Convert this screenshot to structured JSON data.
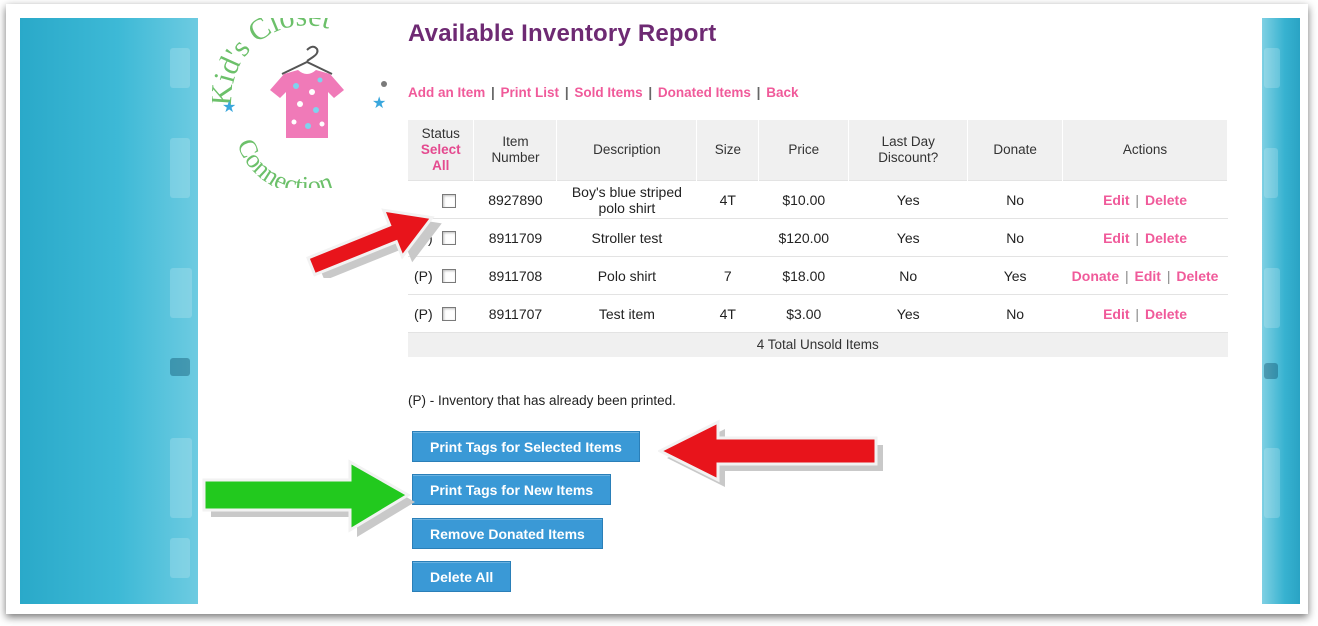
{
  "logo": {
    "text_top": "Kid's Closet",
    "text_bottom": "Connection"
  },
  "page": {
    "title": "Available Inventory Report"
  },
  "links": [
    {
      "label": "Add an Item"
    },
    {
      "label": "Print List"
    },
    {
      "label": "Sold Items"
    },
    {
      "label": "Donated Items"
    },
    {
      "label": "Back"
    }
  ],
  "table": {
    "headers": {
      "status": "Status",
      "select_all": "Select All",
      "item_number": "Item Number",
      "description": "Description",
      "size": "Size",
      "price": "Price",
      "last_day_discount": "Last Day Discount?",
      "donate": "Donate",
      "actions": "Actions"
    },
    "rows": [
      {
        "status": "",
        "checked": false,
        "item_number": "8927890",
        "description": "Boy's blue striped polo shirt",
        "size": "4T",
        "price": "$10.00",
        "last_day_discount": "Yes",
        "donate": "No",
        "actions": [
          "Edit",
          "Delete"
        ]
      },
      {
        "status": "(P)",
        "checked": false,
        "item_number": "8911709",
        "description": "Stroller test",
        "size": "",
        "price": "$120.00",
        "last_day_discount": "Yes",
        "donate": "No",
        "actions": [
          "Edit",
          "Delete"
        ]
      },
      {
        "status": "(P)",
        "checked": false,
        "item_number": "8911708",
        "description": "Polo shirt",
        "size": "7",
        "price": "$18.00",
        "last_day_discount": "No",
        "donate": "Yes",
        "actions": [
          "Donate",
          "Edit",
          "Delete"
        ]
      },
      {
        "status": "(P)",
        "checked": false,
        "item_number": "8911707",
        "description": "Test item",
        "size": "4T",
        "price": "$3.00",
        "last_day_discount": "Yes",
        "donate": "No",
        "actions": [
          "Edit",
          "Delete"
        ]
      }
    ],
    "total": "4 Total Unsold Items"
  },
  "note": "(P) - Inventory that has already been printed.",
  "buttons": {
    "print_selected": "Print Tags for Selected Items",
    "print_new": "Print Tags for New Items",
    "remove_donated": "Remove Donated Items",
    "delete_all": "Delete All"
  },
  "colors": {
    "title": "#6e2a73",
    "link": "#f05a9a",
    "button": "#3a99d6",
    "annotation_red": "#e8141b",
    "annotation_green": "#22c91e",
    "background_teal": "#2aa9c9"
  }
}
